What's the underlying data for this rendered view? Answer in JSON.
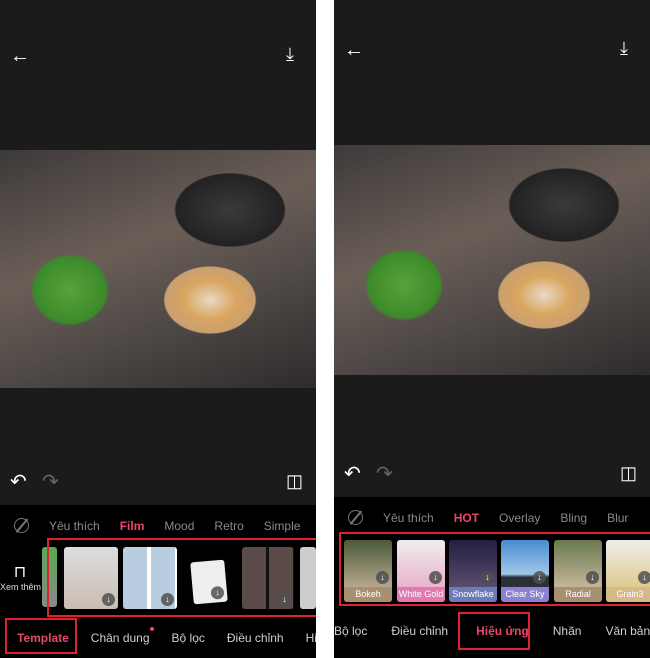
{
  "left": {
    "categories": [
      "Yêu thích",
      "Film",
      "Mood",
      "Retro",
      "Simple"
    ],
    "active_category": "Film",
    "more_label": "Xem thêm",
    "tabs": [
      "Template",
      "Chân dung",
      "Bộ lọc",
      "Điều chỉnh",
      "Hi"
    ],
    "active_tab": "Template"
  },
  "right": {
    "categories": [
      "Yêu thích",
      "HOT",
      "Overlay",
      "Bling",
      "Blur"
    ],
    "active_category": "HOT",
    "effects": [
      {
        "label": "Bokeh",
        "color": "#a88f72"
      },
      {
        "label": "White Gold",
        "color": "#e07ab0"
      },
      {
        "label": "Snowflake",
        "color": "#6d79b8"
      },
      {
        "label": "Clear Sky",
        "color": "#8f7fd0"
      },
      {
        "label": "Radial",
        "color": "#a88f72"
      },
      {
        "label": "Grain3",
        "color": "#d6b985"
      }
    ],
    "tabs": [
      "Bộ lọc",
      "Điều chỉnh",
      "Hiệu ứng",
      "Nhãn",
      "Văn bản"
    ],
    "active_tab": "Hiệu ứng"
  },
  "colors": {
    "accent": "#e8466a",
    "highlight_box": "#e0222e",
    "background": "#1b1b1b"
  }
}
